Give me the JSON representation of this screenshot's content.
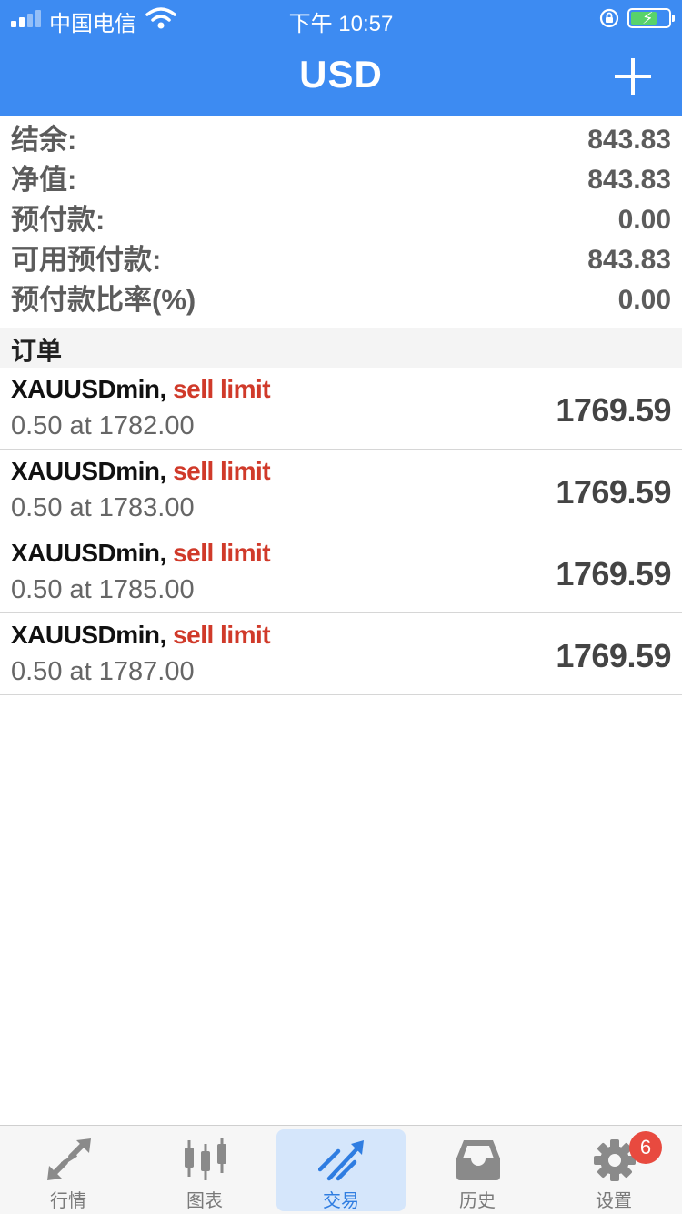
{
  "status_bar": {
    "carrier": "中国电信",
    "time": "下午 10:57"
  },
  "nav": {
    "title": "USD"
  },
  "summary": [
    {
      "label": "结余:",
      "value": "843.83"
    },
    {
      "label": "净值:",
      "value": "843.83"
    },
    {
      "label": "预付款:",
      "value": "0.00"
    },
    {
      "label": "可用预付款:",
      "value": "843.83"
    },
    {
      "label": "预付款比率(%)",
      "value": "0.00"
    }
  ],
  "orders_section": {
    "title": "订单"
  },
  "orders": [
    {
      "symbol": "XAUUSDmin,",
      "type": "sell limit",
      "detail": "0.50 at 1782.00",
      "price": "1769.59"
    },
    {
      "symbol": "XAUUSDmin,",
      "type": "sell limit",
      "detail": "0.50 at 1783.00",
      "price": "1769.59"
    },
    {
      "symbol": "XAUUSDmin,",
      "type": "sell limit",
      "detail": "0.50 at 1785.00",
      "price": "1769.59"
    },
    {
      "symbol": "XAUUSDmin,",
      "type": "sell limit",
      "detail": "0.50 at 1787.00",
      "price": "1769.59"
    }
  ],
  "tabs": [
    {
      "label": "行情",
      "icon": "quotes-arrows-icon"
    },
    {
      "label": "图表",
      "icon": "candlestick-chart-icon"
    },
    {
      "label": "交易",
      "icon": "trade-trend-icon",
      "active": true
    },
    {
      "label": "历史",
      "icon": "history-inbox-icon"
    },
    {
      "label": "设置",
      "icon": "gear-icon",
      "badge": "6"
    }
  ],
  "colors": {
    "header": "#3d8bf2",
    "sell": "#d03a2a",
    "tab_active_bg": "#d5e6fb",
    "tab_active_text": "#2f7de1",
    "badge": "#e84a3f"
  }
}
